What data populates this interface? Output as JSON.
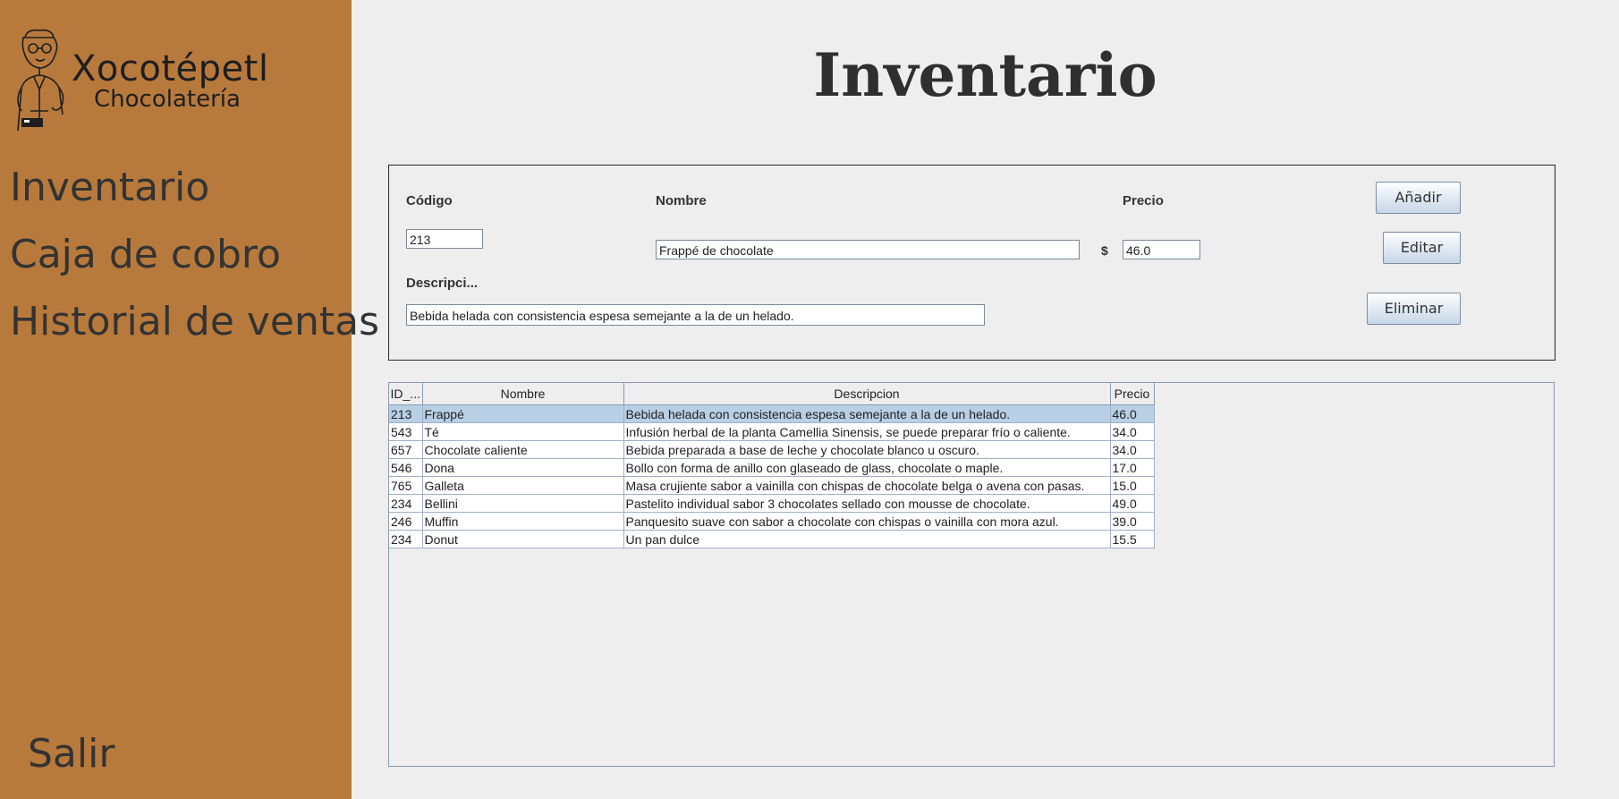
{
  "sidebar": {
    "logo": {
      "name": "Xocotépetl",
      "subtitle": "Chocolatería"
    },
    "nav": {
      "inventario": "Inventario",
      "caja": "Caja de cobro",
      "historial": "Historial de ventas"
    },
    "salir": "Salir",
    "background_color": "#b87a3c"
  },
  "page_title": "Inventario",
  "form": {
    "codigo_label": "Código",
    "codigo_value": "213",
    "nombre_label": "Nombre",
    "nombre_value": "Frappé de chocolate",
    "precio_label": "Precio",
    "currency_symbol": "$",
    "precio_value": "46.0",
    "descripcion_label": "Descripci...",
    "descripcion_value": "Bebida helada con consistencia espesa semejante a la de un helado.",
    "buttons": {
      "anadir": "Añadir",
      "editar": "Editar",
      "eliminar": "Eliminar"
    }
  },
  "table": {
    "columns": [
      "ID_...",
      "Nombre",
      "Descripcion",
      "Precio"
    ],
    "rows": [
      [
        "213",
        "Frappé",
        "Bebida helada con consistencia espesa semejante a la de un helado.",
        "46.0"
      ],
      [
        "543",
        "Té",
        "Infusión herbal de la planta Camellia Sinensis, se puede preparar frío o caliente.",
        "34.0"
      ],
      [
        "657",
        "Chocolate caliente",
        "Bebida preparada a base de leche y chocolate blanco u oscuro.",
        "34.0"
      ],
      [
        "546",
        "Dona",
        "Bollo con forma de anillo con glaseado de glass, chocolate o maple.",
        "17.0"
      ],
      [
        "765",
        "Galleta",
        "Masa crujiente sabor a vainilla con chispas de chocolate belga o avena con pasas.",
        "15.0"
      ],
      [
        "234",
        "Bellini",
        "Pastelito individual sabor 3 chocolates sellado con mousse de chocolate.",
        "49.0"
      ],
      [
        "246",
        "Muffin",
        "Panquesito suave con sabor a chocolate con chispas o vainilla con mora azul.",
        "39.0"
      ],
      [
        "234",
        "Donut",
        "Un pan dulce",
        "15.5"
      ]
    ],
    "selected_row": 0,
    "selection_color": "#b8cfe5"
  }
}
